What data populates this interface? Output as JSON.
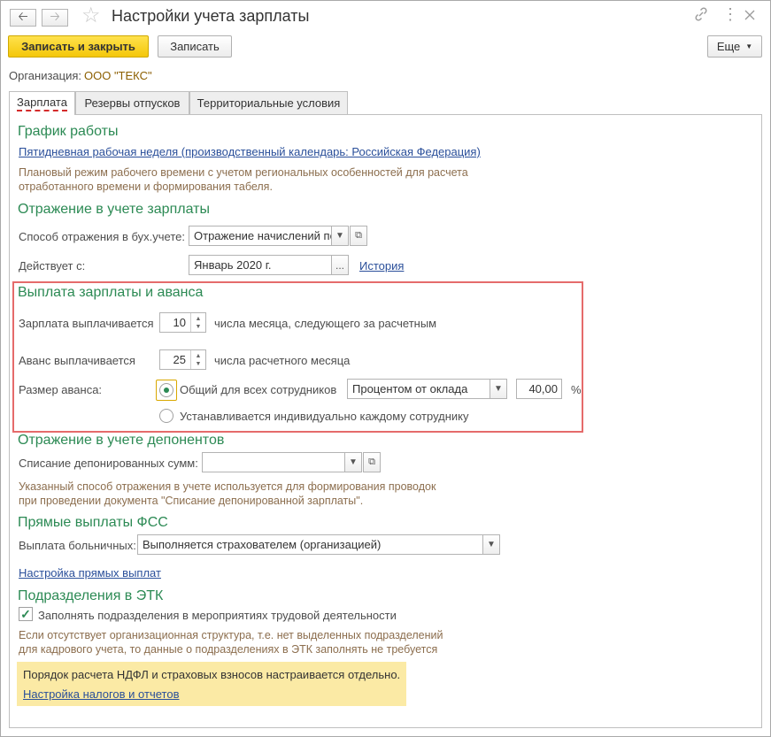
{
  "window": {
    "title": "Настройки учета зарплаты"
  },
  "toolbar": {
    "save_close_label": "Записать и закрыть",
    "save_label": "Записать",
    "more_label": "Еще"
  },
  "organization": {
    "label": "Организация:",
    "value": "ООО \"ТЕКС\""
  },
  "tabs": [
    {
      "label": "Зарплата",
      "active": true
    },
    {
      "label": "Резервы отпусков",
      "active": false
    },
    {
      "label": "Территориальные условия",
      "active": false
    }
  ],
  "work_schedule": {
    "header": "График работы",
    "link": "Пятидневная рабочая неделя (производственный календарь: Российская Федерация)",
    "hint_line1": "Плановый режим рабочего времени с учетом региональных особенностей для расчета",
    "hint_line2": "отработанного времени и формирования табеля."
  },
  "accounting": {
    "header": "Отражение в учете зарплаты",
    "method_label": "Способ отражения в бух.учете:",
    "method_value": "Отражение начислений по",
    "effective_label": "Действует с:",
    "effective_value": "Январь 2020 г.",
    "history_link": "История"
  },
  "payment": {
    "header": "Выплата зарплаты и аванса",
    "salary_label": "Зарплата выплачивается",
    "salary_day": "10",
    "salary_suffix": "числа месяца, следующего за расчетным",
    "advance_label": "Аванс выплачивается",
    "advance_day": "25",
    "advance_suffix": "числа расчетного месяца",
    "advance_size_label": "Размер аванса:",
    "option_common": "Общий для всех сотрудников",
    "option_individual": "Устанавливается индивидуально каждому сотруднику",
    "method_value": "Процентом от оклада",
    "percent_value": "40,00",
    "percent_sign": "%"
  },
  "deponents": {
    "header": "Отражение в учете депонентов",
    "writeoff_label": "Списание депонированных сумм:",
    "writeoff_value": "",
    "hint_line1": "Указанный способ отражения в учете используется для формирования проводок",
    "hint_line2": "при проведении документа \"Списание депонированной зарплаты\"."
  },
  "fss": {
    "header": "Прямые выплаты ФСС",
    "sick_label": "Выплата больничных:",
    "sick_value": "Выполняется страхователем (организацией)",
    "settings_link": "Настройка прямых выплат"
  },
  "etk": {
    "header": "Подразделения в ЭТК",
    "checkbox_label": "Заполнять подразделения в мероприятиях трудовой деятельности",
    "checked": true,
    "hint_line1": "Если отсутствует организационная структура, т.е. нет выделенных подразделений",
    "hint_line2": "для кадрового учета, то данные о подразделениях в ЭТК заполнять не требуется"
  },
  "note": {
    "text": "Порядок расчета НДФЛ и страховых взносов настраивается отдельно.",
    "link": "Настройка налогов и отчетов"
  },
  "colors": {
    "section_header": "#2c8a54",
    "link": "#2a4f9a",
    "hint": "#8c6e4e",
    "primary_button": "#f4c70a",
    "highlight_border": "#e56b6b",
    "note_background": "#fbeaa5"
  }
}
